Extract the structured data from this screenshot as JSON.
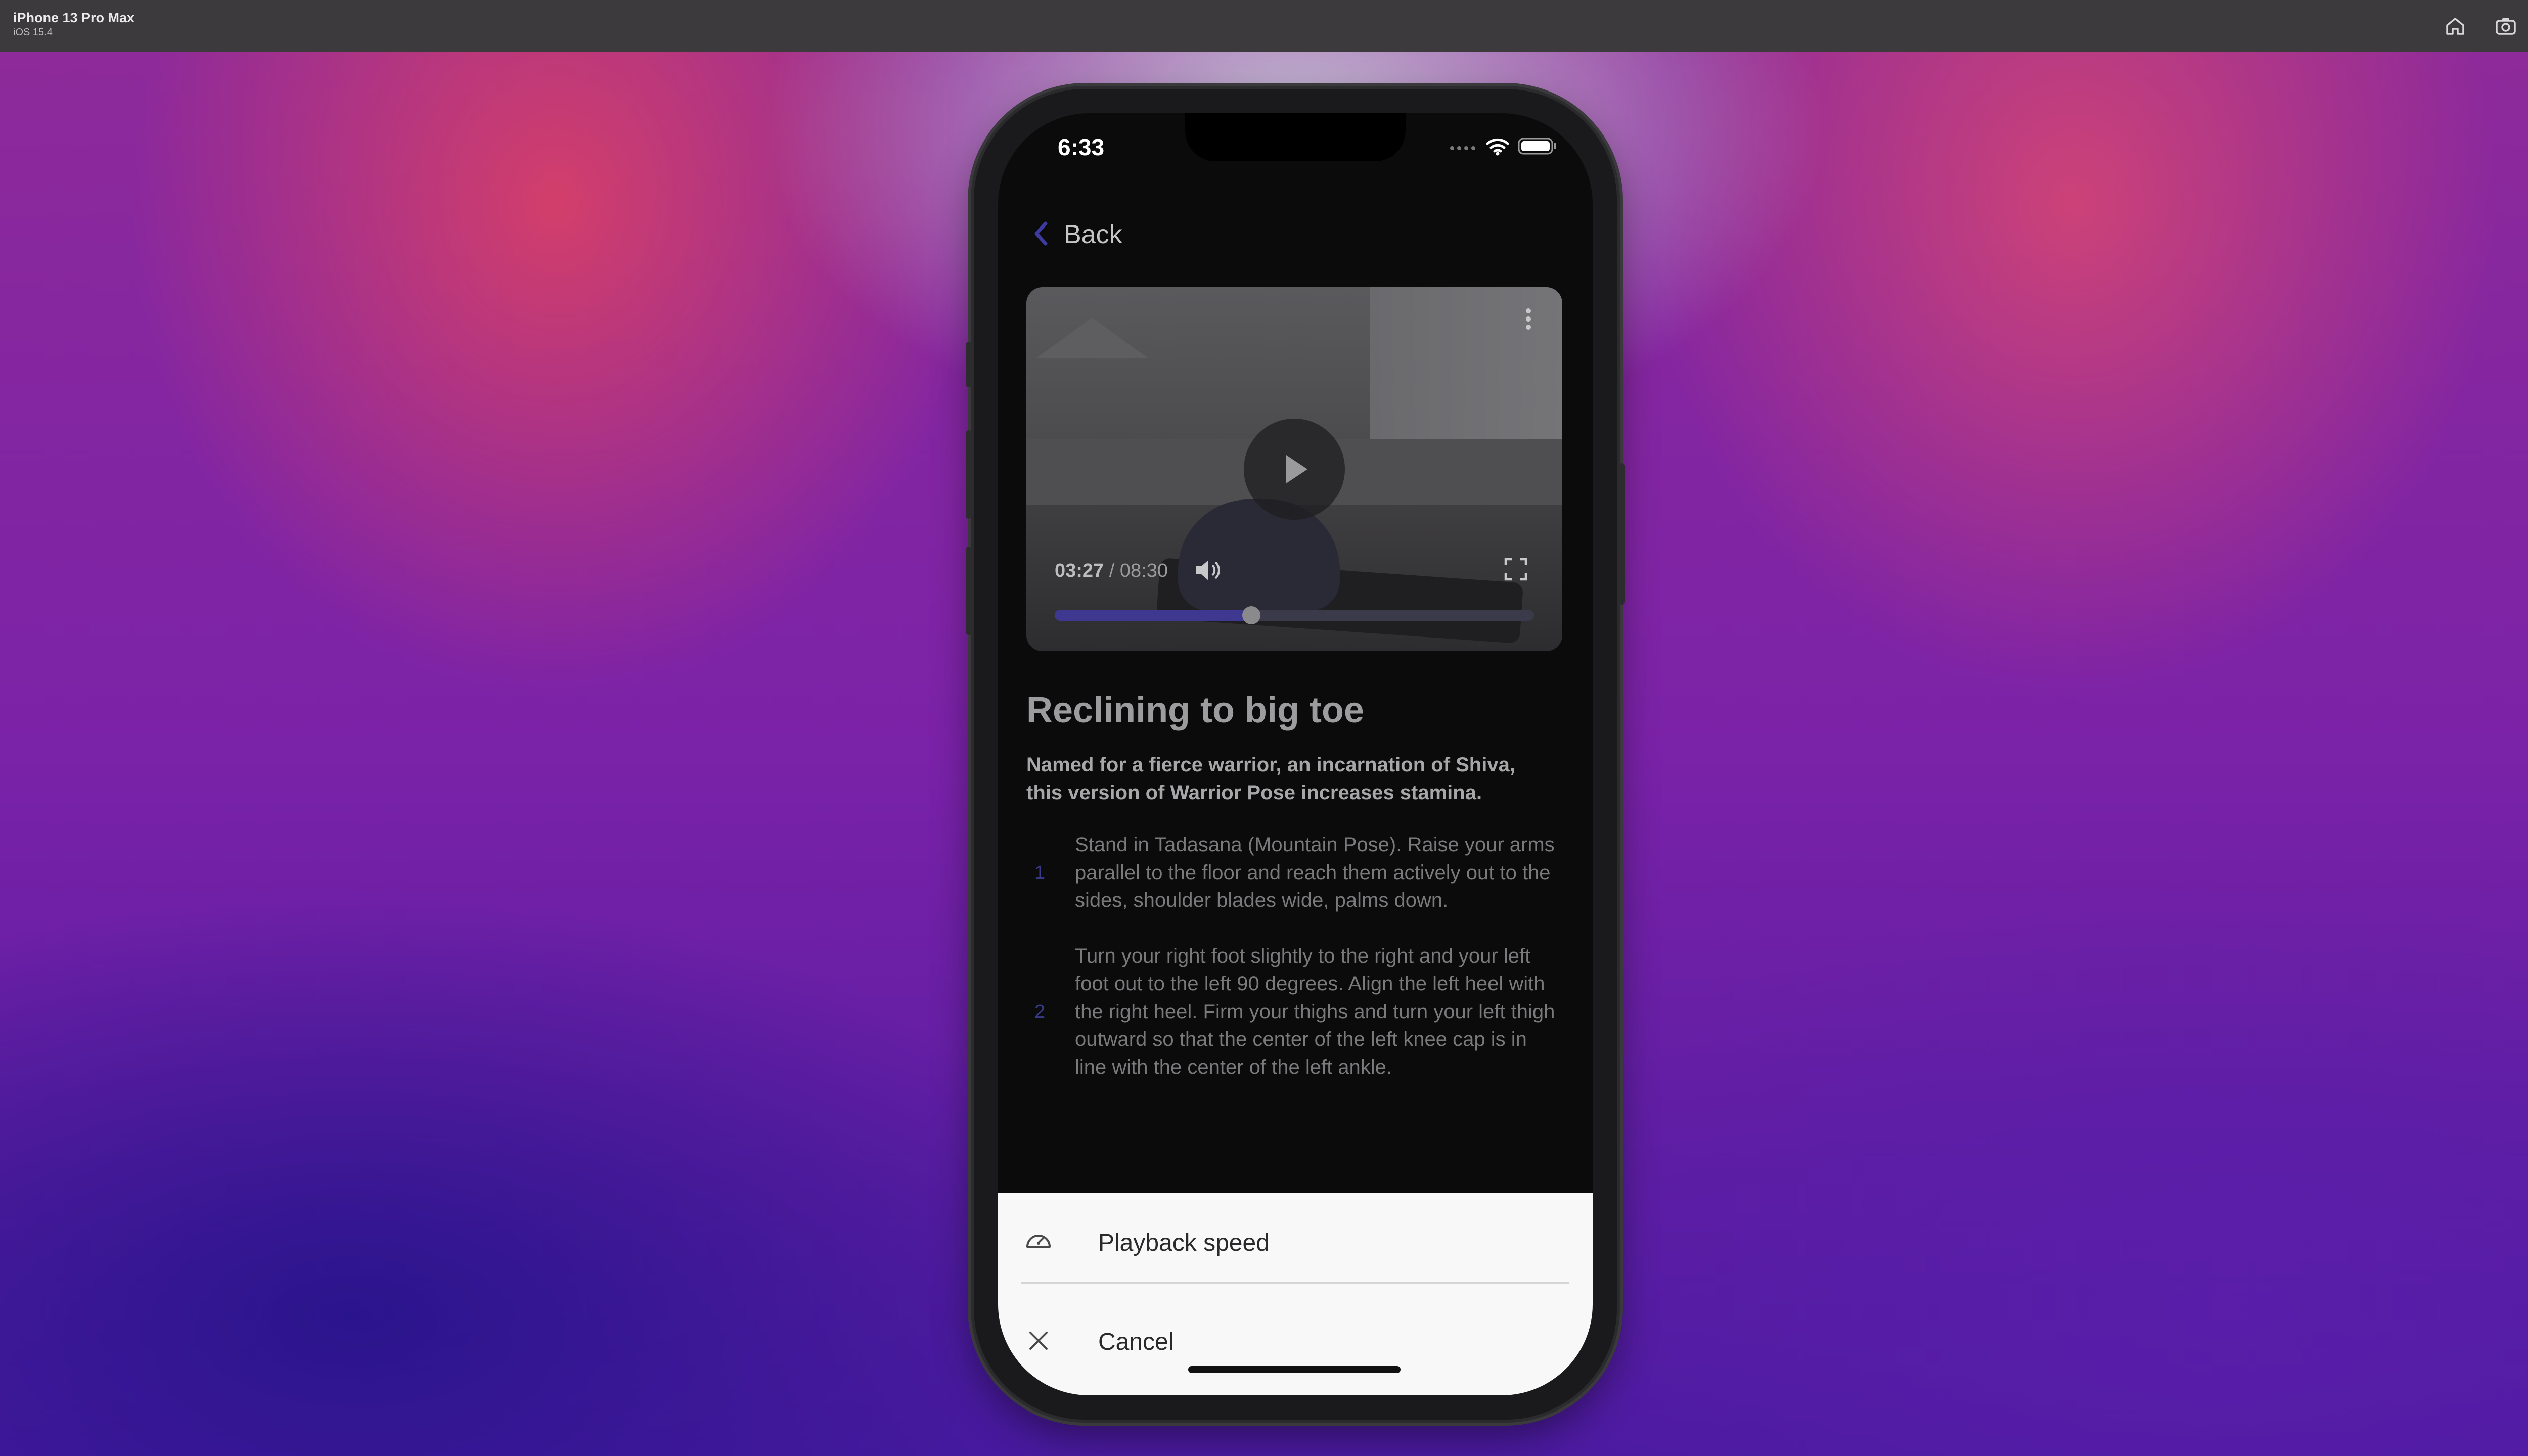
{
  "simulator": {
    "device_name": "iPhone 13 Pro Max",
    "os_version": "iOS 15.4",
    "toolbar_icons": [
      "home-icon",
      "screenshot-icon",
      "rotate-icon"
    ]
  },
  "status_bar": {
    "time": "6:33",
    "icons": [
      "cellular-icon",
      "wifi-icon",
      "battery-icon"
    ]
  },
  "nav": {
    "back_label": "Back"
  },
  "video": {
    "current_time": "03:27",
    "separator": " / ",
    "duration": "08:30",
    "progress": 0.41,
    "accent": "#3e3890"
  },
  "exercise": {
    "title": "Reclining to big toe",
    "description": "Named for a fierce warrior, an incarnation of Shiva, this version of Warrior Pose increases stamina.",
    "steps": [
      {
        "number": "1",
        "text": "Stand in Tadasana (Mountain Pose). Raise your arms parallel to the floor and reach them actively out to the sides, shoulder blades wide, palms down."
      },
      {
        "number": "2",
        "text": "Turn your right foot slightly to the right and your left foot out to the left 90 degrees. Align the left heel with the right heel. Firm your thighs and turn your left thigh outward so that the center of the left knee cap is in line with the center of the left ankle."
      }
    ]
  },
  "action_sheet": {
    "items": [
      {
        "label": "Playback speed",
        "icon": "speedometer-icon"
      },
      {
        "label": "Cancel",
        "icon": "close-icon"
      }
    ]
  }
}
